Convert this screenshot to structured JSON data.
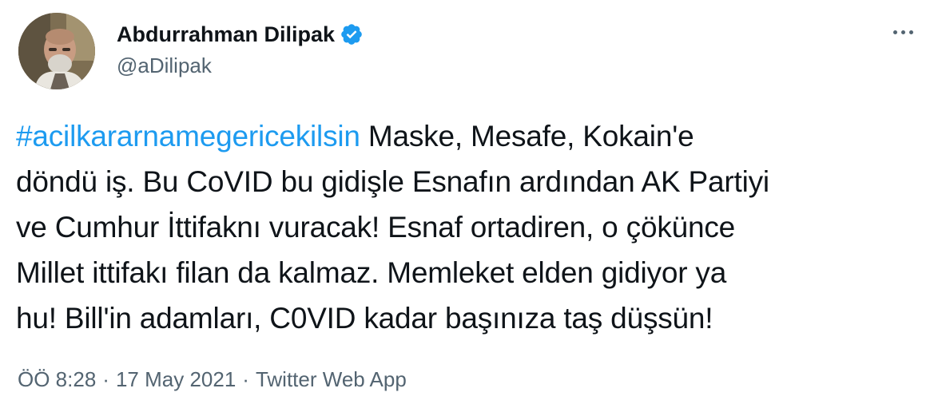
{
  "author": {
    "display_name": "Abdurrahman Dilipak",
    "handle": "@aDilipak",
    "verified": true
  },
  "tweet": {
    "hashtag": "#acilkararnamegericekilsin",
    "first_line_rest": " Maske, Mesafe, Kokain'e",
    "lines": [
      "döndü iş. Bu CoVID bu gidişle Esnafın ardından AK Partiyi",
      "ve Cumhur İttifaknı vuracak! Esnaf ortadiren, o çökünce",
      "Millet ittifakı filan da kalmaz. Memleket elden gidiyor ya",
      "hu! Bill'in adamları, C0VID kadar başınıza taş düşsün!"
    ]
  },
  "meta": {
    "time": "ÖÖ 8:28",
    "separator": "·",
    "date": "17 May 2021",
    "source": "Twitter Web App"
  },
  "colors": {
    "link": "#1d9bf0",
    "secondary_text": "#536471",
    "primary_text": "#0f1419",
    "verified_badge": "#1d9bf0"
  },
  "icons": {
    "verified": "verified-badge-icon",
    "more": "more-options-icon"
  }
}
